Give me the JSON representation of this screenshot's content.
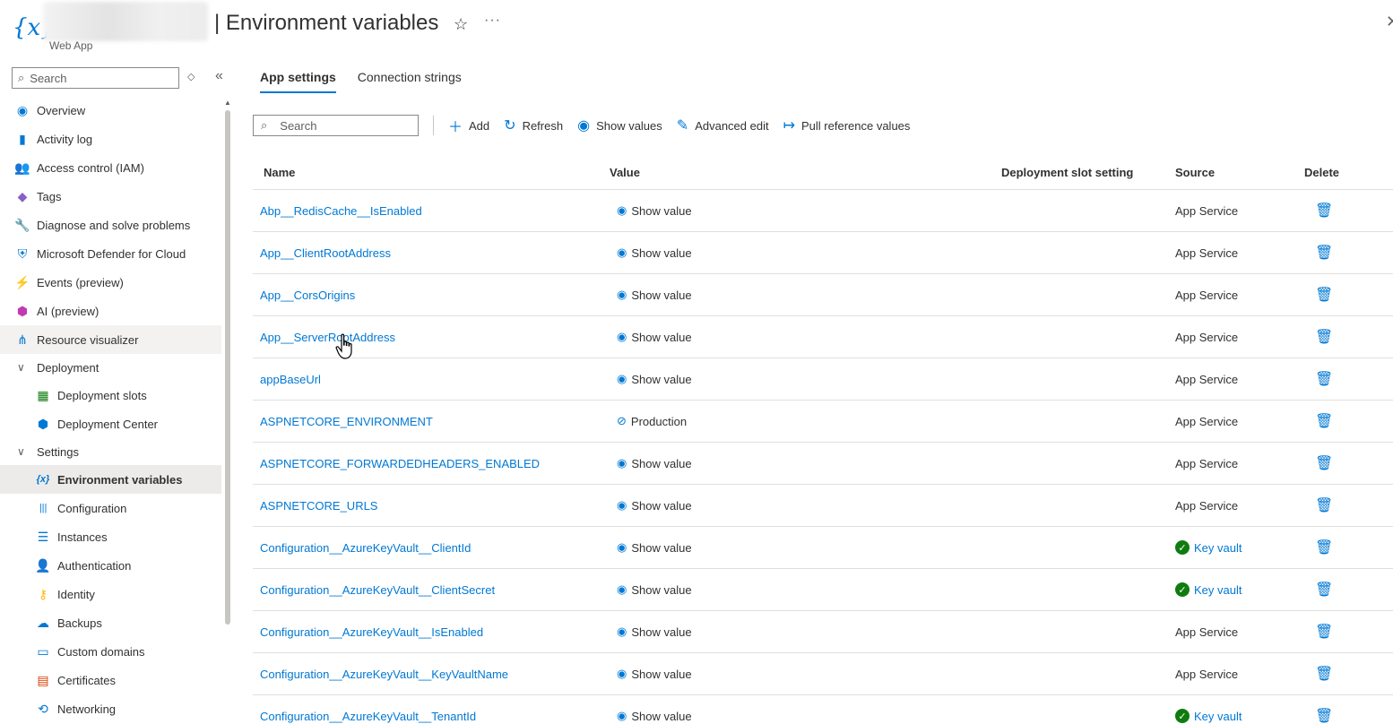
{
  "header": {
    "title": "| Environment variables",
    "subtitle": "Web App",
    "logo_icon": "environment-variables-icon",
    "favorite_icon": "star-icon",
    "more_icon": "more-icon",
    "close_icon": "close-icon"
  },
  "sidebar": {
    "search_placeholder": "Search",
    "items": [
      {
        "label": "Overview",
        "icon": "overview-icon",
        "color": "#0078d4",
        "glyph": "◉"
      },
      {
        "label": "Activity log",
        "icon": "activity-log-icon",
        "color": "#0078d4",
        "glyph": "▮"
      },
      {
        "label": "Access control (IAM)",
        "icon": "access-control-icon",
        "color": "#0078d4",
        "glyph": "👥"
      },
      {
        "label": "Tags",
        "icon": "tags-icon",
        "color": "#8661c5",
        "glyph": "◆"
      },
      {
        "label": "Diagnose and solve problems",
        "icon": "wrench-icon",
        "color": "#323130",
        "glyph": "🔧"
      },
      {
        "label": "Microsoft Defender for Cloud",
        "icon": "shield-icon",
        "color": "#0078d4",
        "glyph": "⛨"
      },
      {
        "label": "Events (preview)",
        "icon": "lightning-icon",
        "color": "#ffb900",
        "glyph": "⚡"
      },
      {
        "label": "AI (preview)",
        "icon": "ai-icon",
        "color": "#c239b3",
        "glyph": "⬢"
      },
      {
        "label": "Resource visualizer",
        "icon": "resource-visualizer-icon",
        "color": "#0078d4",
        "glyph": "⋔"
      }
    ],
    "deployment": {
      "label": "Deployment",
      "items": [
        {
          "label": "Deployment slots",
          "icon": "deployment-slots-icon",
          "color": "#107c10",
          "glyph": "▦"
        },
        {
          "label": "Deployment Center",
          "icon": "deployment-center-icon",
          "color": "#0078d4",
          "glyph": "⬢"
        }
      ]
    },
    "settings": {
      "label": "Settings",
      "items": [
        {
          "label": "Environment variables",
          "icon": "environment-variables-icon",
          "color": "#0078d4",
          "glyph": "{x}"
        },
        {
          "label": "Configuration",
          "icon": "configuration-icon",
          "color": "#0078d4",
          "glyph": "|||"
        },
        {
          "label": "Instances",
          "icon": "instances-icon",
          "color": "#0078d4",
          "glyph": "☰"
        },
        {
          "label": "Authentication",
          "icon": "authentication-icon",
          "color": "#0078d4",
          "glyph": "👤"
        },
        {
          "label": "Identity",
          "icon": "identity-icon",
          "color": "#ffb900",
          "glyph": "⚷"
        },
        {
          "label": "Backups",
          "icon": "backups-icon",
          "color": "#0078d4",
          "glyph": "☁"
        },
        {
          "label": "Custom domains",
          "icon": "custom-domains-icon",
          "color": "#0078d4",
          "glyph": "▭"
        },
        {
          "label": "Certificates",
          "icon": "certificates-icon",
          "color": "#d83b01",
          "glyph": "▤"
        },
        {
          "label": "Networking",
          "icon": "networking-icon",
          "color": "#0078d4",
          "glyph": "⟲"
        }
      ]
    }
  },
  "tabs": [
    "App settings",
    "Connection strings"
  ],
  "toolbar": {
    "search_placeholder": "Search",
    "add": "Add",
    "refresh": "Refresh",
    "show_values": "Show values",
    "advanced_edit": "Advanced edit",
    "pull_reference_values": "Pull reference values"
  },
  "table": {
    "columns": [
      "Name",
      "Value",
      "Deployment slot setting",
      "Source",
      "Delete"
    ],
    "rows": [
      {
        "name": "Abp__RedisCache__IsEnabled",
        "value": "Show value",
        "value_icon": "eye-icon",
        "source": "App Service",
        "key_vault": false
      },
      {
        "name": "App__ClientRootAddress",
        "value": "Show value",
        "value_icon": "eye-icon",
        "source": "App Service",
        "key_vault": false
      },
      {
        "name": "App__CorsOrigins",
        "value": "Show value",
        "value_icon": "eye-icon",
        "source": "App Service",
        "key_vault": false
      },
      {
        "name": "App__ServerRootAddress",
        "value": "Show value",
        "value_icon": "eye-icon",
        "source": "App Service",
        "key_vault": false
      },
      {
        "name": "appBaseUrl",
        "value": "Show value",
        "value_icon": "eye-icon",
        "source": "App Service",
        "key_vault": false
      },
      {
        "name": "ASPNETCORE_ENVIRONMENT",
        "value": "Production",
        "value_icon": "hide-eye-icon",
        "source": "App Service",
        "key_vault": false
      },
      {
        "name": "ASPNETCORE_FORWARDEDHEADERS_ENABLED",
        "value": "Show value",
        "value_icon": "eye-icon",
        "source": "App Service",
        "key_vault": false
      },
      {
        "name": "ASPNETCORE_URLS",
        "value": "Show value",
        "value_icon": "eye-icon",
        "source": "App Service",
        "key_vault": false
      },
      {
        "name": "Configuration__AzureKeyVault__ClientId",
        "value": "Show value",
        "value_icon": "eye-icon",
        "source": "Key vault",
        "key_vault": true
      },
      {
        "name": "Configuration__AzureKeyVault__ClientSecret",
        "value": "Show value",
        "value_icon": "eye-icon",
        "source": "Key vault",
        "key_vault": true
      },
      {
        "name": "Configuration__AzureKeyVault__IsEnabled",
        "value": "Show value",
        "value_icon": "eye-icon",
        "source": "App Service",
        "key_vault": false
      },
      {
        "name": "Configuration__AzureKeyVault__KeyVaultName",
        "value": "Show value",
        "value_icon": "eye-icon",
        "source": "App Service",
        "key_vault": false
      },
      {
        "name": "Configuration__AzureKeyVault__TenantId",
        "value": "Show value",
        "value_icon": "eye-icon",
        "source": "Key vault",
        "key_vault": true
      }
    ]
  },
  "colors": {
    "accent": "#0078d4",
    "success": "#107c10"
  }
}
